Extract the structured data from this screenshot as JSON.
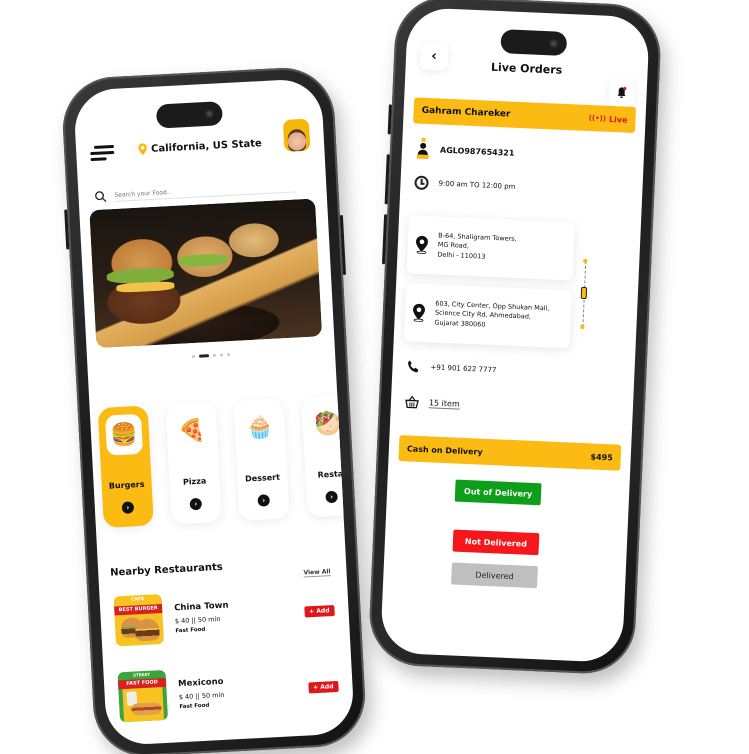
{
  "colors": {
    "accent_yellow": "#fbbb12",
    "add_red": "#e0161b",
    "live_red": "#e0161b",
    "out_of_delivery_green": "#0e9f1a",
    "not_delivered_red": "#f5171c",
    "delivered_gray": "#bfbfbf"
  },
  "home_screen": {
    "header": {
      "menu_icon": "hamburger-menu-icon",
      "location_icon": "map-pin-icon",
      "location": "California, US State",
      "avatar": "user-avatar"
    },
    "search": {
      "placeholder": "Search your Food..",
      "icon": "search-icon"
    },
    "banner": {
      "image": "burgers-and-fries-photo",
      "carousel_pages": 5,
      "active_page": 2
    },
    "categories": [
      {
        "label": "Burgers",
        "icon": "burger-icon",
        "glyph": "🍔",
        "active": true
      },
      {
        "label": "Pizza",
        "icon": "pizza-slice-icon",
        "glyph": "🍕",
        "active": false
      },
      {
        "label": "Dessert",
        "icon": "cupcake-icon",
        "glyph": "🧁",
        "active": false
      },
      {
        "label": "Resta",
        "icon": "restaurant-food-icon",
        "glyph": "🥙",
        "active": false
      }
    ],
    "nearby": {
      "title": "Nearby Restaurants",
      "view_all": "View All",
      "restaurants": [
        {
          "name": "China Town",
          "meta": "$ 40 || 50 min",
          "type": "Fast Food",
          "badge_top": "CAFE",
          "badge_band": "BEST BURGER",
          "add_label": "+ Add"
        },
        {
          "name": "Mexicono",
          "meta": "$ 40 || 50 min",
          "type": "Fast Food",
          "badge_top": "STREET",
          "badge_band": "FAST FOOD",
          "add_label": "+ Add"
        }
      ]
    }
  },
  "orders_screen": {
    "title": "Live Orders",
    "back_icon": "chevron-left-icon",
    "bell_icon": "notification-bell-icon",
    "customer_name": "Gahram Chareker",
    "live_label": "Live",
    "order_id": "AGLO987654321",
    "time_window": "9:00 am TO 12:00 pm",
    "pickup_address": [
      "B-64, Shaligram Towers,",
      "MG Road,",
      "Delhi - 110013"
    ],
    "drop_address": [
      "603, City Center, Opp Shukan Mall,",
      "Science City Rd, Ahmedabad,",
      "Gujarat 380060"
    ],
    "phone": "+91 901 622 7777",
    "items": "15 item",
    "payment_method": "Cash on Delivery",
    "amount": "$495",
    "buttons": {
      "out_of_delivery": "Out of Delivery",
      "not_delivered": "Not Delivered",
      "delivered": "Delivered"
    }
  }
}
